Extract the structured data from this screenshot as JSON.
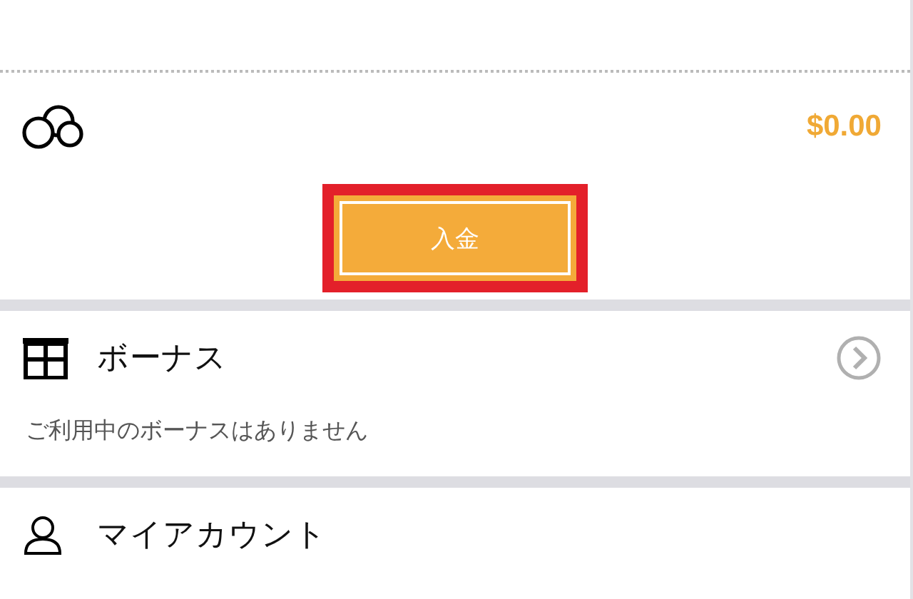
{
  "balance": {
    "amount": "$0.00"
  },
  "deposit_button": {
    "label": "入金",
    "highlighted": true
  },
  "bonus": {
    "title": "ボーナス",
    "message": "ご利用中のボーナスはありません"
  },
  "account": {
    "title": "マイアカウント"
  }
}
